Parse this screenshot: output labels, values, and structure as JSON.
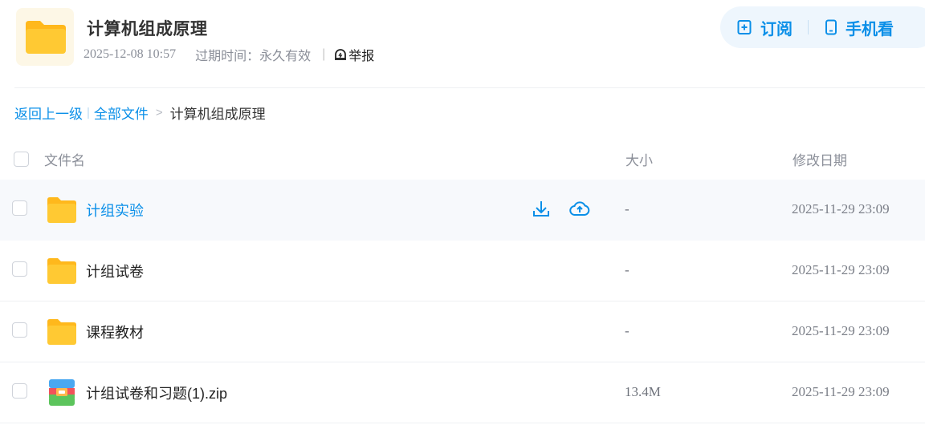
{
  "header": {
    "title": "计算机组成原理",
    "date": "2025-12-08 10:57",
    "expire": "过期时间：永久有效",
    "separator": "|",
    "report_label": "举报",
    "subscribe_label": "订阅",
    "mobile_label": "手机看"
  },
  "breadcrumb": {
    "back_label": "返回上一级",
    "bar": "|",
    "all_files_label": "全部文件",
    "arrow": ">",
    "current": "计算机组成原理"
  },
  "table": {
    "columns": [
      "文件名",
      "大小",
      "修改日期"
    ],
    "rows": [
      {
        "name": "计组实验",
        "type": "folder",
        "size": "-",
        "date": "2025-11-29 23:09",
        "hovered": true
      },
      {
        "name": "计组试卷",
        "type": "folder",
        "size": "-",
        "date": "2025-11-29 23:09",
        "hovered": false
      },
      {
        "name": "课程教材",
        "type": "folder",
        "size": "-",
        "date": "2025-11-29 23:09",
        "hovered": false
      },
      {
        "name": "计组试卷和习题(1).zip",
        "type": "zip",
        "size": "13.4M",
        "date": "2025-11-29 23:09",
        "hovered": false
      }
    ]
  },
  "icons": {
    "share_folder": "folder-icon",
    "report": "alarm-icon",
    "subscribe": "bookmark-add-icon",
    "mobile": "phone-icon",
    "download": "download-icon",
    "save_to_cloud": "cloud-save-icon",
    "folder": "folder-icon",
    "archive": "zip-archive-icon"
  },
  "colors": {
    "accent": "#0a8fe8",
    "folder_yellow": "#ffc52c",
    "row_hover": "#f7f9fc"
  }
}
